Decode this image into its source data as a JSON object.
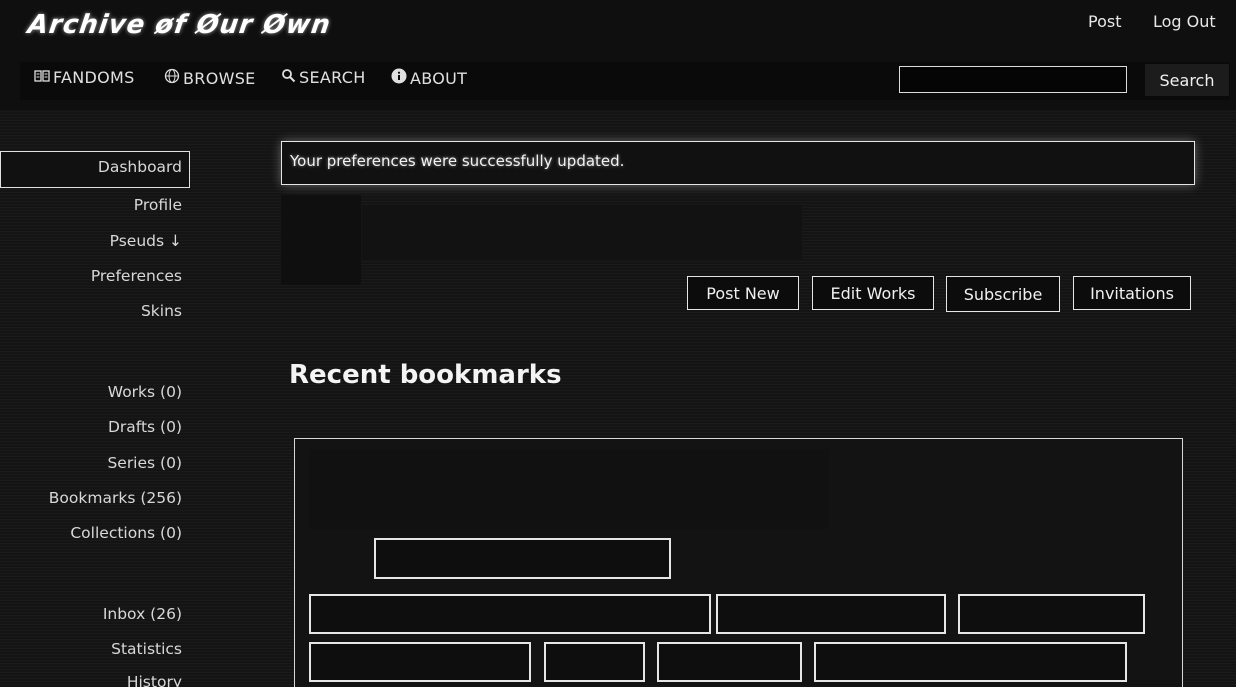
{
  "header": {
    "logo": "Archive øf Øur Øwn",
    "user_links": [
      "Post",
      "Log Out"
    ]
  },
  "nav": {
    "items": [
      {
        "label": "FANDOMS",
        "icon": "book-icon"
      },
      {
        "label": "BROWSE",
        "icon": "globe-icon"
      },
      {
        "label": "SEARCH",
        "icon": "search-icon"
      },
      {
        "label": "ABOUT",
        "icon": "info-icon"
      }
    ],
    "search": {
      "value": "",
      "button_label": "Search"
    }
  },
  "sidebar": {
    "group1": [
      "Dashboard",
      "Profile",
      "Pseuds ↓",
      "Preferences",
      "Skins"
    ],
    "group2": [
      "Works (0)",
      "Drafts (0)",
      "Series (0)",
      "Bookmarks (256)",
      "Collections (0)"
    ],
    "group3": [
      "Inbox (26)",
      "Statistics",
      "History"
    ]
  },
  "notice": "Your preferences were successfully updated.",
  "actions": [
    "Post New",
    "Edit Works",
    "Subscribe",
    "Invitations"
  ],
  "main": {
    "recent_heading": "Recent bookmarks"
  }
}
